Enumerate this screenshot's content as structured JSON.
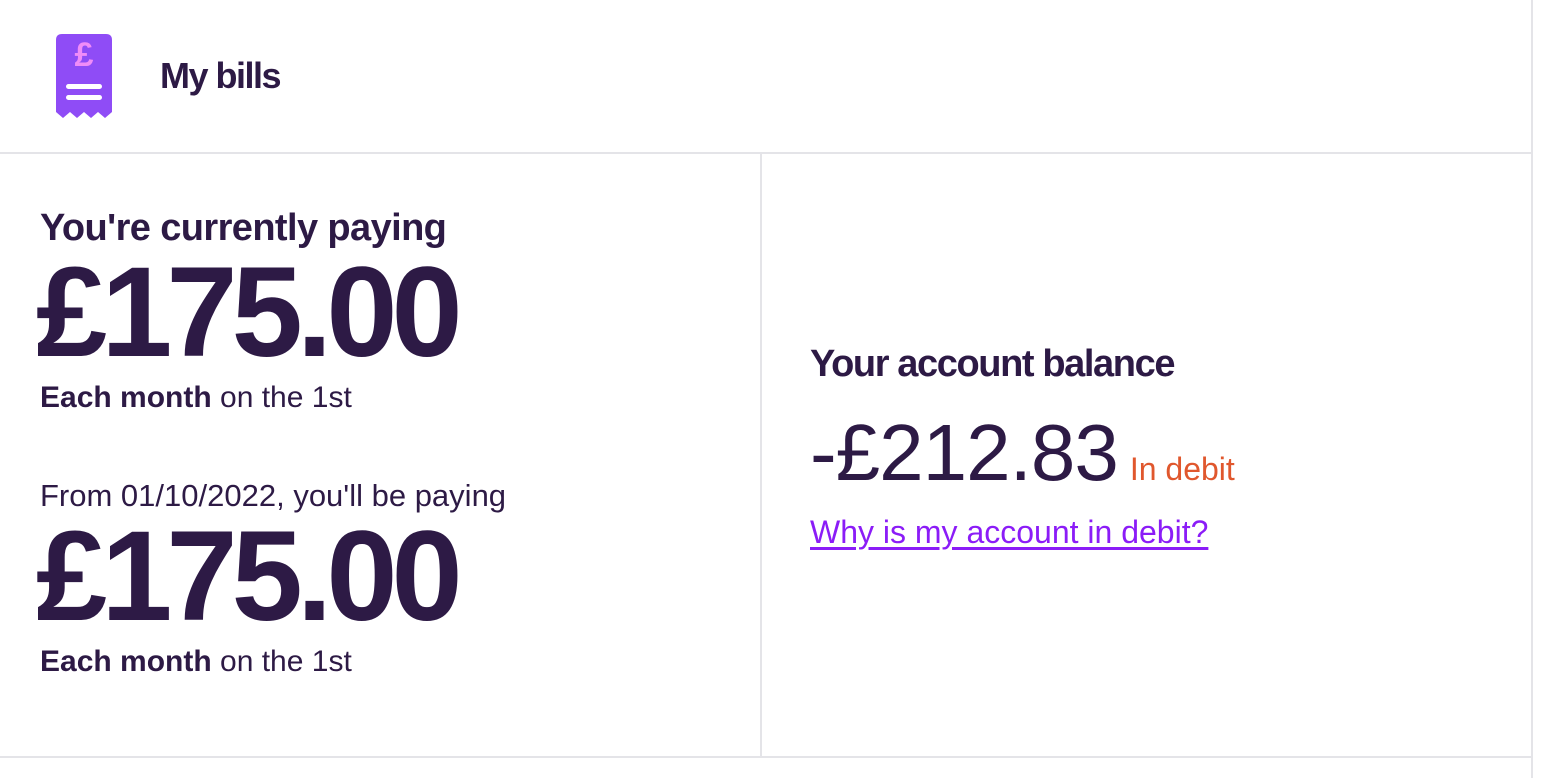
{
  "header": {
    "title": "My bills",
    "icon": "receipt-pound-icon",
    "icon_color": "#8f4cf6",
    "icon_accent": "#f08cf8"
  },
  "current_payment": {
    "label": "You're currently paying",
    "amount": "£175.00",
    "frequency_bold": "Each month",
    "frequency_rest": " on the 1st"
  },
  "future_payment": {
    "label": "From 01/10/2022, you'll be paying",
    "amount": "£175.00",
    "frequency_bold": "Each month",
    "frequency_rest": " on the 1st"
  },
  "balance": {
    "title": "Your account balance",
    "amount": "-£212.83",
    "status": "In debit",
    "status_color": "#e0572d",
    "link": "Why is my account in debit?",
    "link_color": "#8b1cf7"
  },
  "colors": {
    "text": "#2d1a45",
    "border": "#e4e4e8"
  }
}
